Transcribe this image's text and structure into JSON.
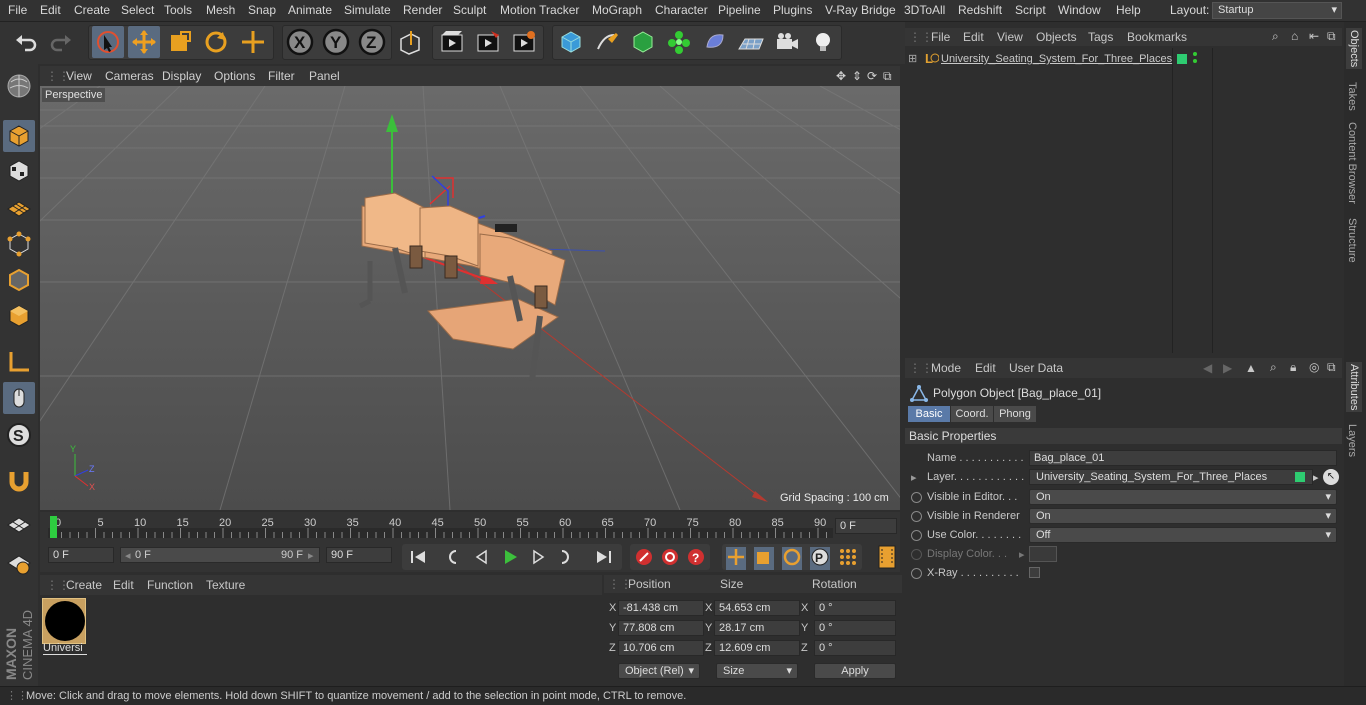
{
  "menu": [
    "File",
    "Edit",
    "Create",
    "Select",
    "Tools",
    "Mesh",
    "Snap",
    "Animate",
    "Simulate",
    "Render",
    "Sculpt",
    "Motion Tracker",
    "MoGraph",
    "Character",
    "Pipeline",
    "Plugins",
    "V-Ray Bridge",
    "3DToAll",
    "Redshift",
    "Script",
    "Window",
    "Help"
  ],
  "layout": {
    "label": "Layout:",
    "value": "Startup"
  },
  "viewport": {
    "menu": [
      "View",
      "Cameras",
      "Display",
      "Options",
      "Filter",
      "Panel"
    ],
    "label": "Perspective",
    "grid_spacing": "Grid Spacing : 100 cm"
  },
  "timeline": {
    "ticks": [
      "0",
      "5",
      "10",
      "15",
      "20",
      "25",
      "30",
      "35",
      "40",
      "45",
      "50",
      "55",
      "60",
      "65",
      "70",
      "75",
      "80",
      "85",
      "90"
    ],
    "end_field": "0 F"
  },
  "playbar": {
    "start": "0 F",
    "range_start": "0 F",
    "range_end": "90 F",
    "end": "90 F"
  },
  "materials": {
    "menu": [
      "Create",
      "Edit",
      "Function",
      "Texture"
    ],
    "items": [
      {
        "name": "Universi",
        "color": "#000000"
      }
    ]
  },
  "coords": {
    "headers": [
      "Position",
      "Size",
      "Rotation"
    ],
    "rows": [
      {
        "axis": "X",
        "pos": "-81.438 cm",
        "size_axis": "X",
        "size": "54.653 cm",
        "rot_axis": "X",
        "rot": "0 °"
      },
      {
        "axis": "Y",
        "pos": "77.808 cm",
        "size_axis": "Y",
        "size": "28.17 cm",
        "rot_axis": "Y",
        "rot": "0 °"
      },
      {
        "axis": "Z",
        "pos": "10.706 cm",
        "size_axis": "Z",
        "size": "12.609 cm",
        "rot_axis": "Z",
        "rot": "0 °"
      }
    ],
    "mode": "Object (Rel)",
    "size_mode": "Size",
    "apply": "Apply"
  },
  "objects": {
    "menu": [
      "File",
      "Edit",
      "View",
      "Objects",
      "Tags",
      "Bookmarks"
    ],
    "tree": [
      {
        "name": "University_Seating_System_For_Three_Places",
        "color": "#e0a030"
      }
    ]
  },
  "attributes": {
    "menu": [
      "Mode",
      "Edit",
      "User Data"
    ],
    "title": "Polygon Object [Bag_place_01]",
    "tabs": [
      "Basic",
      "Coord.",
      "Phong"
    ],
    "section": "Basic Properties",
    "props": [
      {
        "label": "Name . . . . . . . . . . .",
        "value": "Bag_place_01",
        "type": "text"
      },
      {
        "label": "Layer. . . . . . . . . . . .",
        "value": "University_Seating_System_For_Three_Places",
        "type": "layer"
      },
      {
        "label": "Visible in Editor. . .",
        "value": "On",
        "type": "dropdown"
      },
      {
        "label": "Visible in Renderer",
        "value": "On",
        "type": "dropdown"
      },
      {
        "label": "Use Color. . . . . . . .",
        "value": "Off",
        "type": "dropdown"
      },
      {
        "label": "Display Color. . .",
        "value": "",
        "type": "color"
      },
      {
        "label": "X-Ray . . . . . . . . . .",
        "value": "",
        "type": "check"
      }
    ]
  },
  "right_tabs": [
    "Objects",
    "Takes",
    "Content Browser",
    "Structure",
    "Attributes",
    "Layers"
  ],
  "status": "Move: Click and drag to move elements. Hold down SHIFT to quantize movement / add to the selection in point mode, CTRL to remove.",
  "brand": {
    "line1": "MAXON",
    "line2": "CINEMA 4D"
  }
}
